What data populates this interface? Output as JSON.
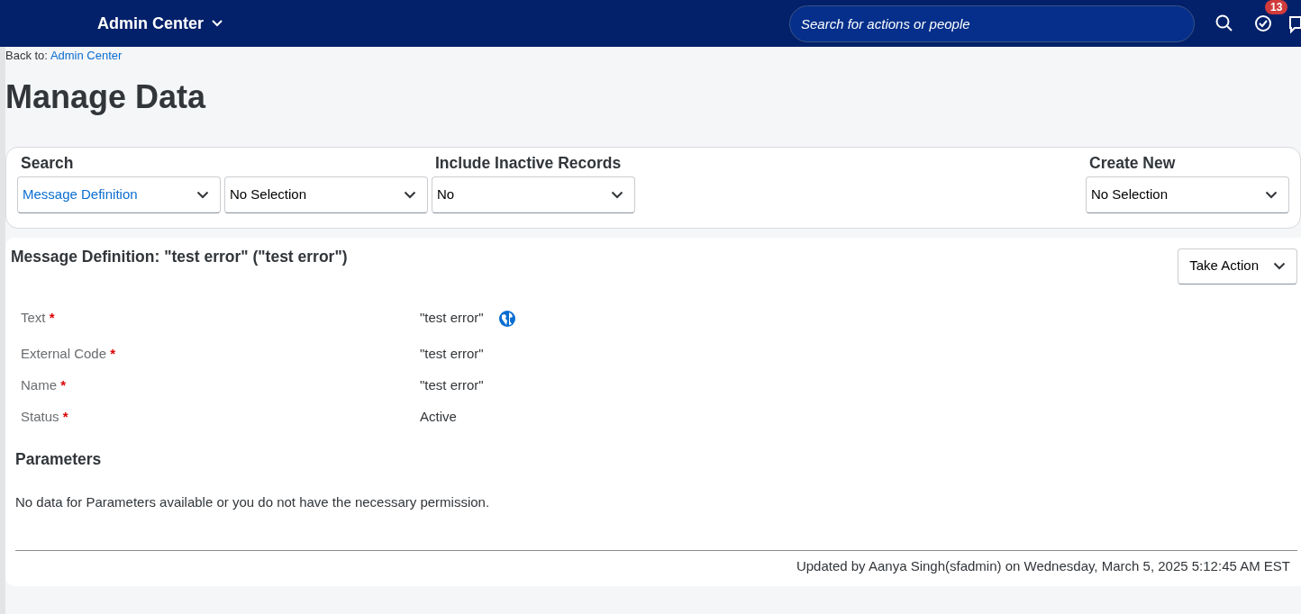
{
  "header": {
    "title": "Admin Center",
    "search": {
      "placeholder": "Search for actions or people"
    },
    "todo_badge": "13"
  },
  "breadcrumb": {
    "prefix": "Back to:",
    "link": "Admin Center"
  },
  "page_title": "Manage Data",
  "search_panel": {
    "search_label": "Search",
    "inactive_label": "Include Inactive Records",
    "create_label": "Create New",
    "search_dropdowns": [
      {
        "value": "Message Definition",
        "kind": "link"
      },
      {
        "value": "No Selection",
        "kind": "plain"
      }
    ],
    "inactive_dropdown": {
      "value": "No"
    },
    "create_dropdown": {
      "value": "No Selection"
    }
  },
  "record": {
    "title": "Message Definition: \"test error\" (\"test error\")",
    "action_button": "Take Action",
    "fields": [
      {
        "label": "Text",
        "required_mark": "*",
        "value": "\"test error\"",
        "translatable": true
      },
      {
        "label": "External Code",
        "required_mark": "*",
        "value": "\"test error\"",
        "translatable": false
      },
      {
        "label": "Name",
        "required_mark": "*",
        "value": "\"test error\"",
        "translatable": false
      },
      {
        "label": "Status",
        "required_mark": "*",
        "value": "Active",
        "translatable": false
      }
    ],
    "parameters_title": "Parameters",
    "parameters_empty": "No data for Parameters available or you do not have the necessary permission.",
    "footer": "Updated by Aanya Singh(sfadmin) on Wednesday, March 5, 2025 5:12:45 AM EST"
  }
}
